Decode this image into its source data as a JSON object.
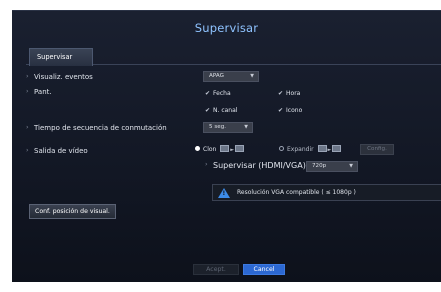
{
  "window": {
    "title": "Supervisar"
  },
  "tabs": [
    {
      "label": "Supervisar"
    }
  ],
  "settings": {
    "event_display": {
      "label": "Visualiz. eventos",
      "value": "APAG"
    },
    "screen": {
      "label": "Pant.",
      "options": [
        {
          "label": "Fecha",
          "checked": true
        },
        {
          "label": "Hora",
          "checked": true
        },
        {
          "label": "N. canal",
          "checked": true
        },
        {
          "label": "Icono",
          "checked": true
        }
      ]
    },
    "sequence_time": {
      "label": "Tiempo de secuencia de conmutación",
      "value": "5 seg."
    },
    "video_output": {
      "label": "Salida de vídeo",
      "clone_label": "Clon",
      "clone_selected": true,
      "expand_label": "Expandir",
      "expand_selected": false,
      "config_label": "Config.",
      "monitor_label": "Supervisar (HDMI/VGA)",
      "monitor_value": "720p",
      "warning": "Resolución VGA compatible ( ≤ 1080p )"
    }
  },
  "display_position_button": "Conf. posición de visual.",
  "footer": {
    "accept": "Acept.",
    "cancel": "Cancel"
  },
  "colors": {
    "accent": "#2c68d2",
    "title": "#8fc3ff",
    "warning_icon": "#3d8be8"
  },
  "icons": [
    "check-icon",
    "monitor-icon",
    "arrow-icon",
    "warning-icon",
    "chevron-down-icon"
  ]
}
